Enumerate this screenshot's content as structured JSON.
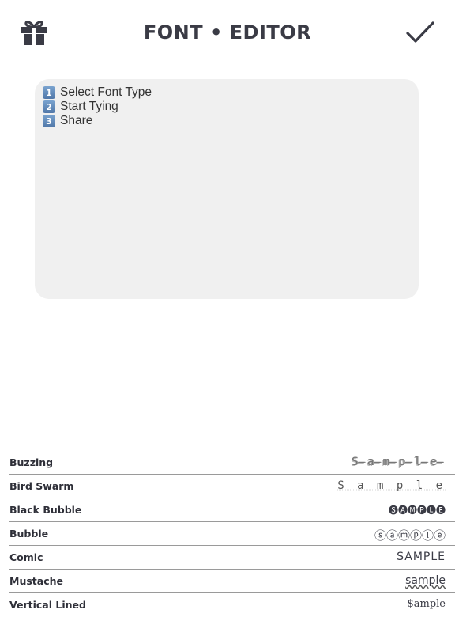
{
  "header": {
    "title": "FONT • EDITOR",
    "left_icon": "gift-icon",
    "right_icon": "checkmark-icon"
  },
  "editor": {
    "steps": [
      {
        "num": "1",
        "text": "Select Font Type"
      },
      {
        "num": "2",
        "text": "Start Tying"
      },
      {
        "num": "3",
        "text": "Share"
      }
    ]
  },
  "fonts": [
    {
      "name": "Buzzing",
      "sample": "S̶a̶m̶p̶l̶e̶"
    },
    {
      "name": "Bird Swarm",
      "sample": "S a m p l e"
    },
    {
      "name": "Black Bubble",
      "sample": "🅢🅐🅜🅟🅛🅔"
    },
    {
      "name": "Bubble",
      "sample": "ⓢⓐⓜⓟⓛⓔ"
    },
    {
      "name": "Comic",
      "sample": "SAMPLE"
    },
    {
      "name": "Mustache",
      "sample": "sample"
    },
    {
      "name": "Vertical Lined",
      "sample": "$ample"
    }
  ],
  "colors": {
    "text": "#3a3b45",
    "editor_bg": "#f0f0f0",
    "divider": "#9a9a9a",
    "keycap": "#5f87b8"
  }
}
